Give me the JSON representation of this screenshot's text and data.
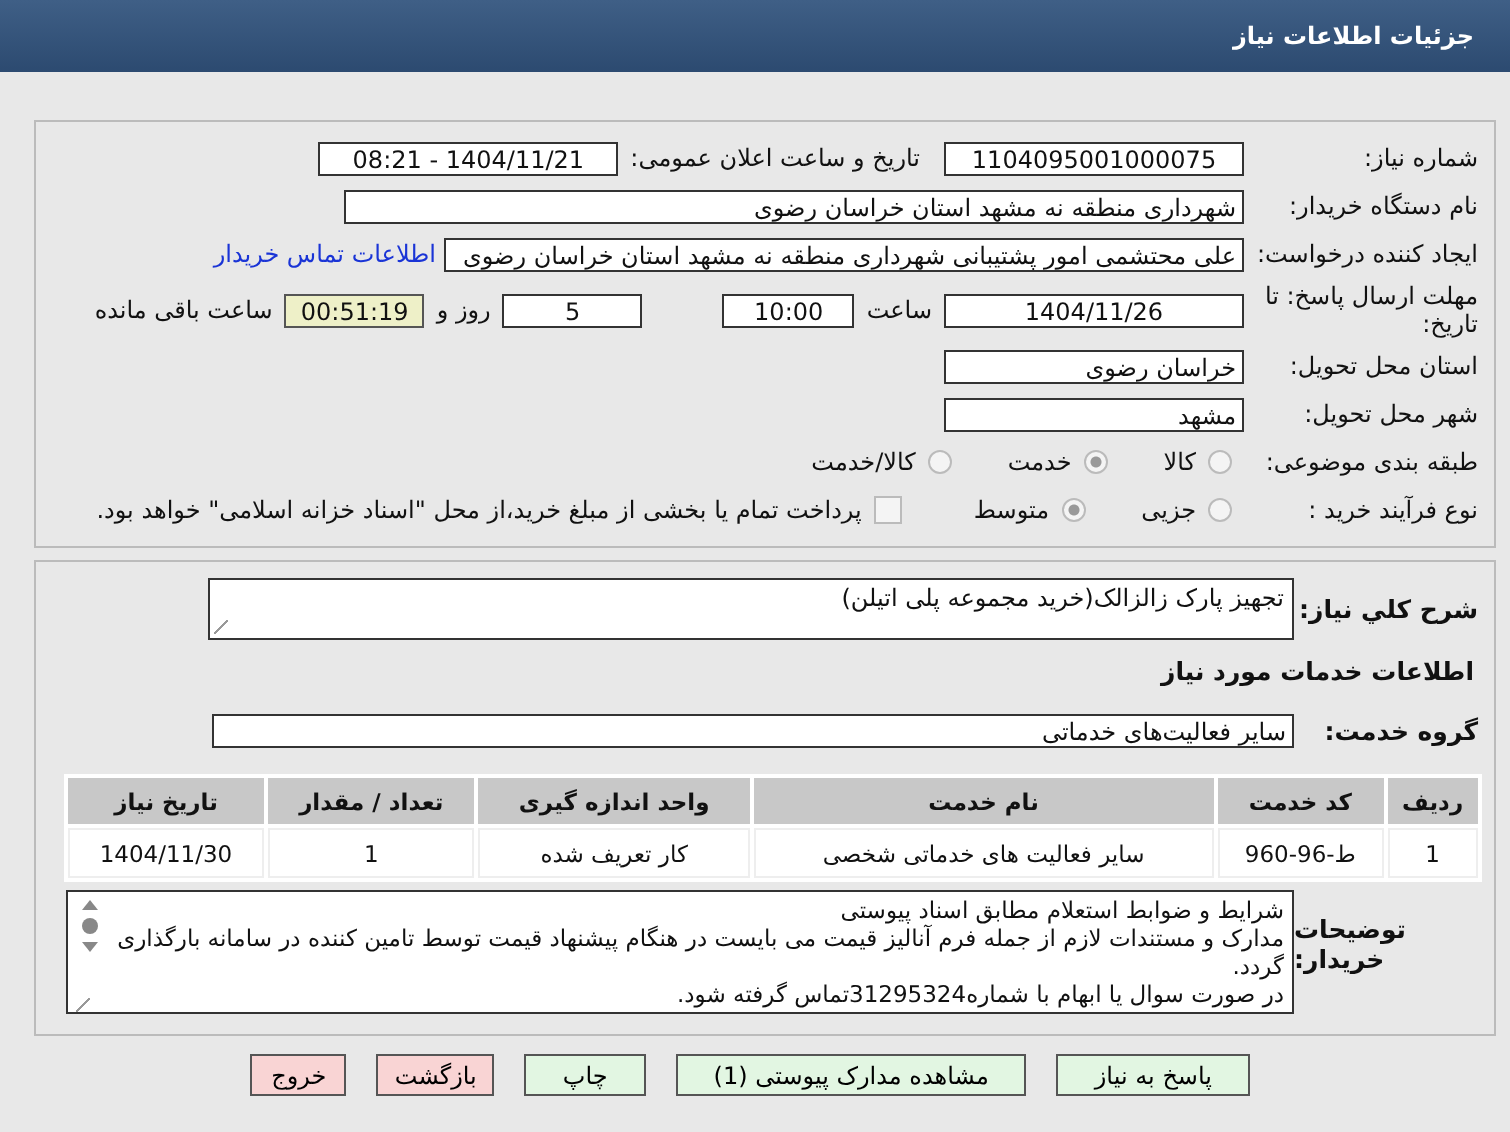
{
  "header": {
    "title": "جزئیات اطلاعات نیاز"
  },
  "details": {
    "need_number": {
      "label": "شماره نیاز:",
      "value": "1104095001000075"
    },
    "announce": {
      "label": "تاریخ و ساعت اعلان عمومی:",
      "value": "1404/11/21 - 08:21"
    },
    "buyer": {
      "label": "نام دستگاه خریدار:",
      "value": "شهرداری منطقه نه مشهد استان خراسان رضوی"
    },
    "requester": {
      "label": "ایجاد کننده درخواست:",
      "value": "علی محتشمی امور پشتیبانی شهرداری منطقه نه مشهد استان خراسان رضوی",
      "link": "اطلاعات تماس خریدار"
    },
    "deadline": {
      "label": "مهلت ارسال پاسخ: تا تاریخ:",
      "date": "1404/11/26",
      "time_label": "ساعت",
      "time": "10:00",
      "days": "5",
      "days_label": "روز و",
      "remaining": "00:51:19",
      "remaining_label": "ساعت باقی مانده"
    },
    "province": {
      "label": "استان محل تحویل:",
      "value": "خراسان رضوی"
    },
    "city": {
      "label": "شهر محل تحویل:",
      "value": "مشهد"
    },
    "category": {
      "label": "طبقه بندی موضوعی:",
      "options": [
        {
          "label": "کالا",
          "selected": false
        },
        {
          "label": "خدمت",
          "selected": true
        },
        {
          "label": "کالا/خدمت",
          "selected": false
        }
      ]
    },
    "process": {
      "label": "نوع فرآیند خرید :",
      "options": [
        {
          "label": "جزیی",
          "selected": false
        },
        {
          "label": "متوسط",
          "selected": true
        }
      ],
      "payment": {
        "label": "پرداخت تمام یا بخشی از مبلغ خرید،از محل \"اسناد خزانه اسلامی\" خواهد بود.",
        "checked": false
      }
    }
  },
  "summary": {
    "label": "شرح کلي نیاز:",
    "value": "تجهیز پارک زالزالک(خرید مجموعه پلی اتیلن)"
  },
  "services": {
    "heading": "اطلاعات خدمات مورد نیاز",
    "group_label": "گروه خدمت:",
    "group": "سایر فعالیت‌های خدماتی",
    "table": {
      "columns": [
        "ردیف",
        "کد خدمت",
        "نام خدمت",
        "واحد اندازه گیری",
        "تعداد / مقدار",
        "تاریخ نیاز"
      ],
      "rows": [
        [
          "1",
          "ط-96-960",
          "سایر فعالیت های خدماتی شخصی",
          "کار تعریف شده",
          "1",
          "1404/11/30"
        ]
      ]
    }
  },
  "description": {
    "label": "توضیحات خریدار:",
    "lines": [
      "شرایط و ضوابط استعلام مطابق اسناد پیوستی",
      "مدارک و مستندات لازم از جمله فرم آنالیز قیمت می بایست در هنگام پیشنهاد قیمت توسط تامین کننده در سامانه بارگذاری گردد.",
      "در صورت سوال یا ابهام با شماره31295324تماس گرفته شود."
    ]
  },
  "buttons": [
    {
      "label": "پاسخ به نیاز",
      "kind": "primary"
    },
    {
      "label": "مشاهده مدارک پیوستی (1)",
      "kind": "primary"
    },
    {
      "label": "چاپ",
      "kind": "primary"
    },
    {
      "label": "بازگشت",
      "kind": "danger"
    },
    {
      "label": "خروج",
      "kind": "danger"
    }
  ]
}
